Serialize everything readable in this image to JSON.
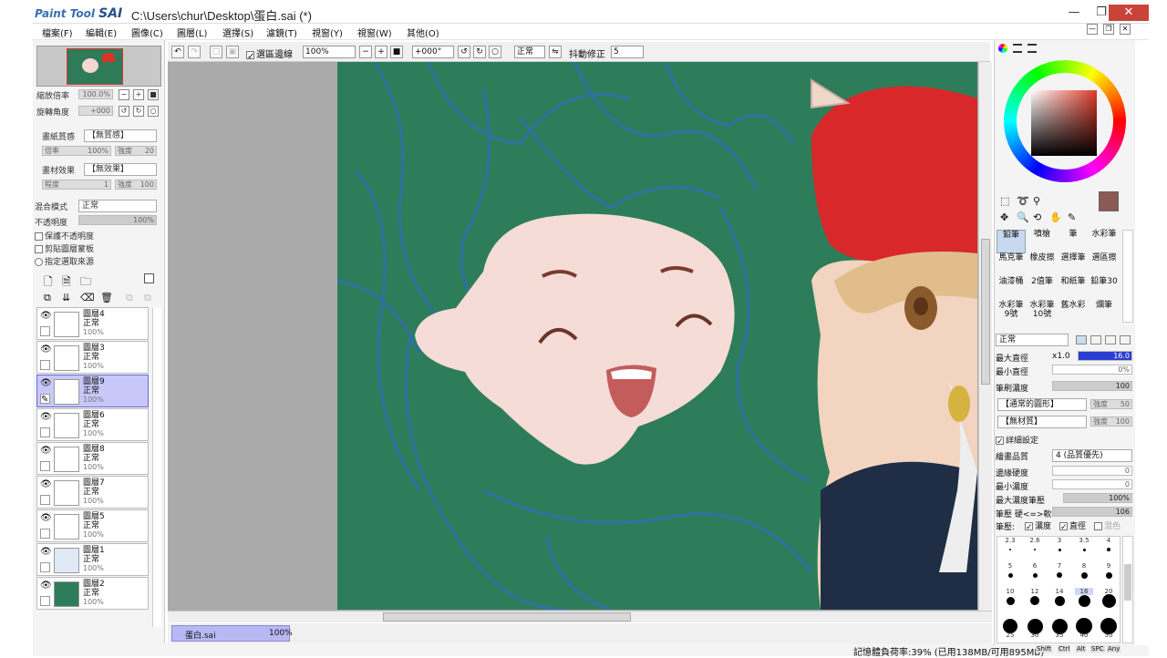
{
  "app": {
    "logo_small": "Paint Tool",
    "logo_big": "SAI",
    "window_title": "C:\\Users\\chur\\Desktop\\蛋白.sai (*)",
    "minimize": "—",
    "maximize": "❐",
    "close": "✕"
  },
  "menu": [
    "檔案(F)",
    "編輯(E)",
    "圖像(C)",
    "圖層(L)",
    "選擇(S)",
    "濾鏡(T)",
    "視窗(Y)",
    "視窗(W)",
    "其他(O)"
  ],
  "menu_window_controls": [
    "—",
    "❐",
    "✕"
  ],
  "left": {
    "zoom_label": "縮放倍率",
    "zoom_value": "100.0%",
    "rotate_label": "旋轉角度",
    "rotate_value": "+000",
    "paper_texture_label": "畫紙質感",
    "paper_texture_value": "【無質感】",
    "paper_scale_label": "倍率",
    "paper_scale_value": "100%",
    "paper_strength_label": "強度",
    "paper_strength_value": "20",
    "material_effect_label": "畫材效果",
    "material_effect_value": "【無效果】",
    "material_level_label": "程度",
    "material_level_value": "1",
    "material_strength_label": "強度",
    "material_strength_value": "100",
    "blend_label": "混合模式",
    "blend_value": "正常",
    "opacity_label": "不透明度",
    "opacity_value": "100%",
    "opt_preserve": "保護不透明度",
    "opt_clip": "剪貼圖層蒙板",
    "opt_source": "指定選取來源",
    "layers": [
      {
        "name": "圖層4",
        "mode": "正常",
        "opacity": "100%",
        "thumb": "#ffffff",
        "visible": true,
        "selected": false
      },
      {
        "name": "圖層3",
        "mode": "正常",
        "opacity": "100%",
        "thumb": "#ffffff",
        "visible": true,
        "selected": false
      },
      {
        "name": "圖層9",
        "mode": "正常",
        "opacity": "100%",
        "thumb": "#ffffff",
        "visible": true,
        "selected": true
      },
      {
        "name": "圖層6",
        "mode": "正常",
        "opacity": "100%",
        "thumb": "#ffffff",
        "visible": true,
        "selected": false
      },
      {
        "name": "圖層8",
        "mode": "正常",
        "opacity": "100%",
        "thumb": "#ffffff",
        "visible": true,
        "selected": false
      },
      {
        "name": "圖層7",
        "mode": "正常",
        "opacity": "100%",
        "thumb": "#ffffff",
        "visible": true,
        "selected": false
      },
      {
        "name": "圖層5",
        "mode": "正常",
        "opacity": "100%",
        "thumb": "#ffffff",
        "visible": true,
        "selected": false
      },
      {
        "name": "圖層1",
        "mode": "正常",
        "opacity": "100%",
        "thumb": "#dfe8f5",
        "visible": true,
        "selected": false
      },
      {
        "name": "圖層2",
        "mode": "正常",
        "opacity": "100%",
        "thumb": "#2e7d5a",
        "visible": true,
        "selected": false
      }
    ]
  },
  "toolbar": {
    "selection_edge_label": "選區邊線",
    "zoom_value": "100%",
    "angle_value": "+000°",
    "mode_value": "正常",
    "stabilizer_label": "抖動修正",
    "stabilizer_value": "5"
  },
  "tab": {
    "name": "蛋白.sai",
    "zoom": "100%"
  },
  "status": {
    "memory": "記憶體負荷率:39% (已用138MB/可用895MB)",
    "keys": [
      "Shift",
      "Ctrl",
      "Alt",
      "SPC",
      "Any"
    ]
  },
  "right": {
    "tools": [
      [
        "鉛筆",
        "噴槍",
        "筆",
        "水彩筆"
      ],
      [
        "馬克筆",
        "橡皮擦",
        "選擇筆",
        "選區擦"
      ],
      [
        "油漆桶",
        "2值筆",
        "和紙筆",
        "鉛筆30"
      ],
      [
        "水彩筆9號",
        "水彩筆10號",
        "舊水彩",
        "爛筆"
      ]
    ],
    "brush_mode": "正常",
    "max_diameter_label": "最大直徑",
    "max_diameter_mult": "x1.0",
    "max_diameter_value": "16.0",
    "min_diameter_label": "最小直徑",
    "min_diameter_value": "0%",
    "density_label": "筆刷濃度",
    "density_value": "100",
    "shape_value": "【通常的圓形】",
    "shape_strength_label": "強度",
    "shape_strength_value": "50",
    "texture_value": "【無材質】",
    "texture_strength_label": "強度",
    "texture_strength_value": "100",
    "detail_label": "詳細設定",
    "quality_label": "繪畫品質",
    "quality_value": "4 (品質優先)",
    "edge_label": "邊緣硬度",
    "edge_value": "0",
    "min_density_label": "最小濃度",
    "min_density_value": "0",
    "max_pressure_label": "最大濃度筆壓",
    "max_pressure_value": "100%",
    "pressure_label": "筆壓 硬<=>軟",
    "pressure_value": "106",
    "pressure_opts_label": "筆壓:",
    "pressure_density": "濃度",
    "pressure_diameter": "直徑",
    "pressure_blend": "混色",
    "brush_sizes_row1": [
      "2.3",
      "2.6",
      "3",
      "3.5",
      "4"
    ],
    "brush_sizes_row2": [
      "5",
      "6",
      "7",
      "8",
      "9"
    ],
    "brush_sizes_row3": [
      "10",
      "12",
      "14",
      "16",
      "20"
    ],
    "brush_sizes_row4": [
      "25",
      "30",
      "35",
      "40",
      "50"
    ]
  },
  "colors": {
    "canvas_bg": "#2e7d5a",
    "current_color": "#8a5a55",
    "accent": "#c9433a"
  }
}
